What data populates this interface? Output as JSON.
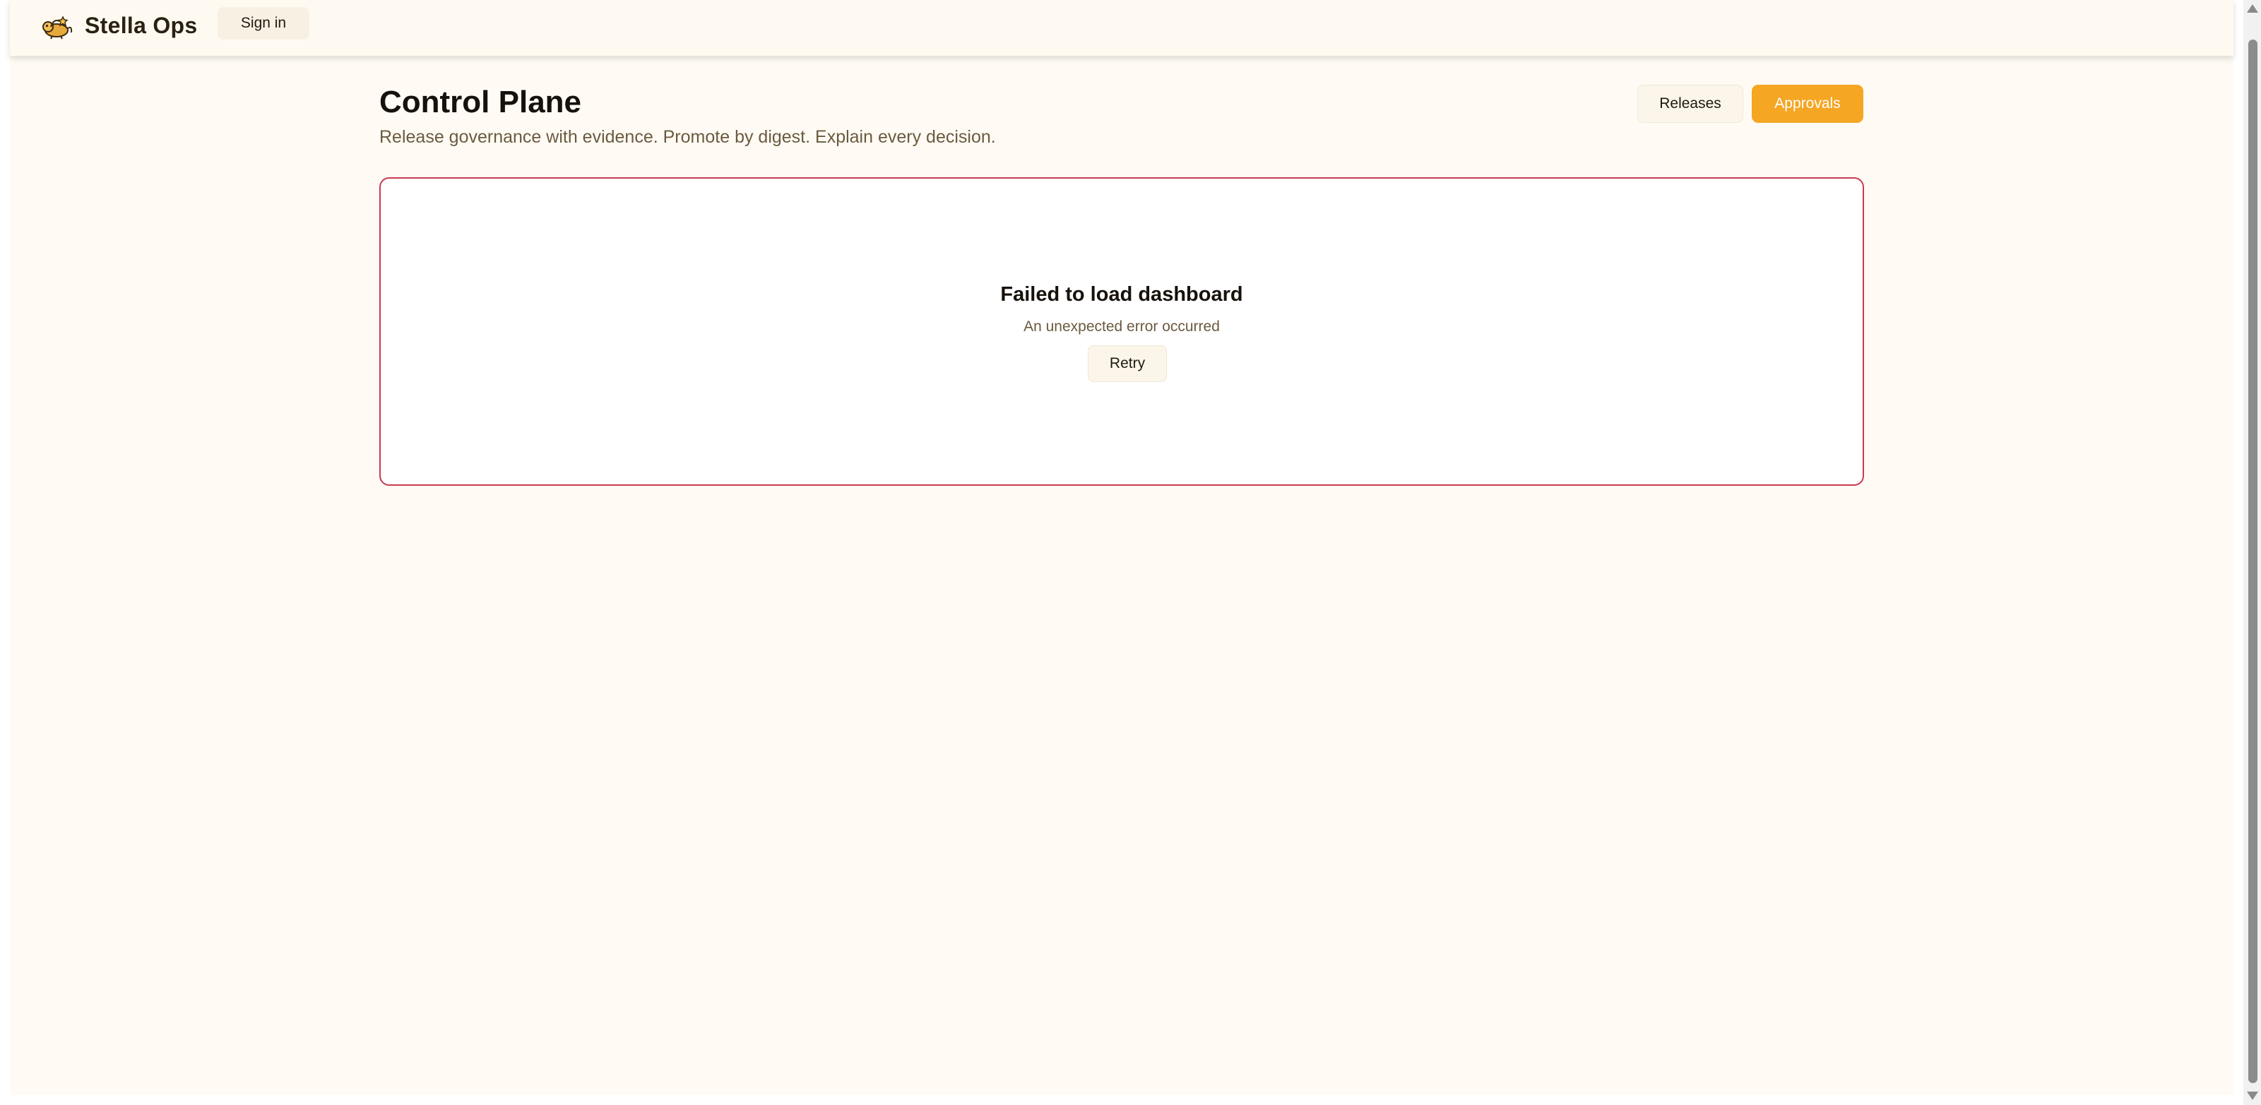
{
  "app": {
    "name": "Stella Ops",
    "logo_icon": "stella-logo-icon"
  },
  "header": {
    "signin_label": "Sign in"
  },
  "page": {
    "title": "Control Plane",
    "subtitle": "Release governance with evidence. Promote by digest. Explain every decision."
  },
  "actions": {
    "releases_label": "Releases",
    "approvals_label": "Approvals"
  },
  "error": {
    "title": "Failed to load dashboard",
    "message": "An unexpected error occurred",
    "retry_label": "Retry"
  },
  "colors": {
    "background": "#fffbf4",
    "accent": "#f5a623",
    "error_border": "#c93b52",
    "muted_text": "#6b5a40"
  }
}
